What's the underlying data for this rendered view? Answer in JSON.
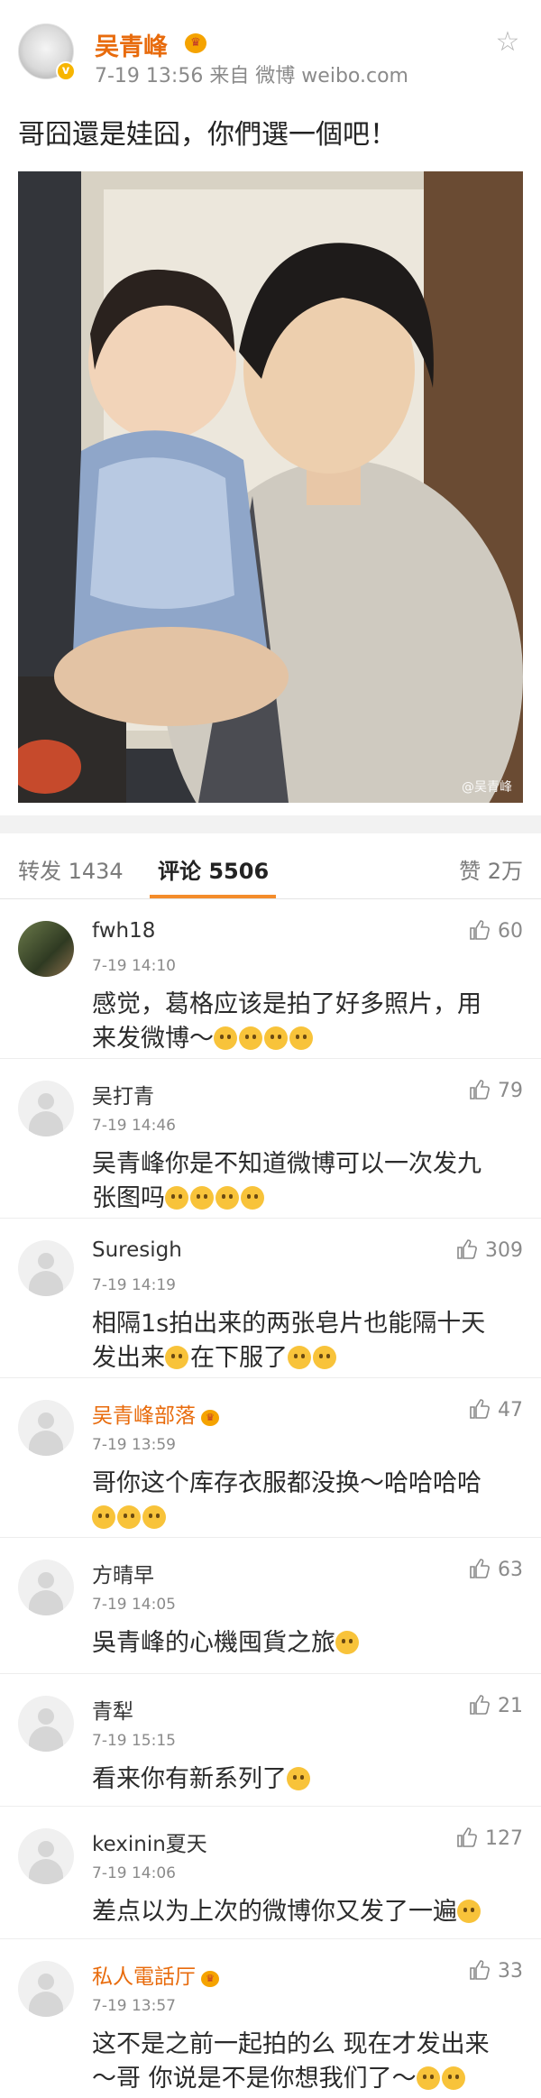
{
  "post": {
    "author": "吴青峰",
    "meta": "7-19 13:56  来自 微博 weibo.com",
    "text": "哥囧還是娃囧，你們選一個吧！",
    "watermark": "@吴青峰"
  },
  "tabs": {
    "repost": "转发 1434",
    "comments": "评论 5506",
    "likes": "赞 2万"
  },
  "comments": [
    {
      "name": "fwh18",
      "time": "7-19 14:10",
      "likes": "60",
      "line1": "感觉，葛格应该是拍了好多照片，用",
      "line2": "来发微博～"
    },
    {
      "name": "吴打青",
      "time": "7-19 14:46",
      "likes": "79",
      "line1": "吴青峰你是不知道微博可以一次发九",
      "line2": "张图吗"
    },
    {
      "name": "Suresigh",
      "time": "7-19 14:19",
      "likes": "309",
      "line1": "相隔1s拍出来的两张皂片也能隔十天",
      "line2": "发出来",
      "line2b": "在下服了"
    },
    {
      "name": "吴青峰部落",
      "time": "7-19 13:59",
      "likes": "47",
      "line1": "哥你这个库存衣服都没换～哈哈哈哈",
      "line2": ""
    },
    {
      "name": "方晴早",
      "time": "7-19 14:05",
      "likes": "63",
      "line1": "吳青峰的心機囤貨之旅",
      "line2": ""
    },
    {
      "name": "青犁",
      "time": "7-19 15:15",
      "likes": "21",
      "line1": "看来你有新系列了",
      "line2": ""
    },
    {
      "name": "kexinin夏天",
      "time": "7-19 14:06",
      "likes": "127",
      "line1": "差点以为上次的微博你又发了一遍",
      "line2": ""
    },
    {
      "name": "私人電話厅",
      "time": "7-19 13:57",
      "likes": "33",
      "line1": "这不是之前一起拍的么 现在才发出来",
      "line2": "～哥 你说是不是你想我们了～"
    }
  ]
}
